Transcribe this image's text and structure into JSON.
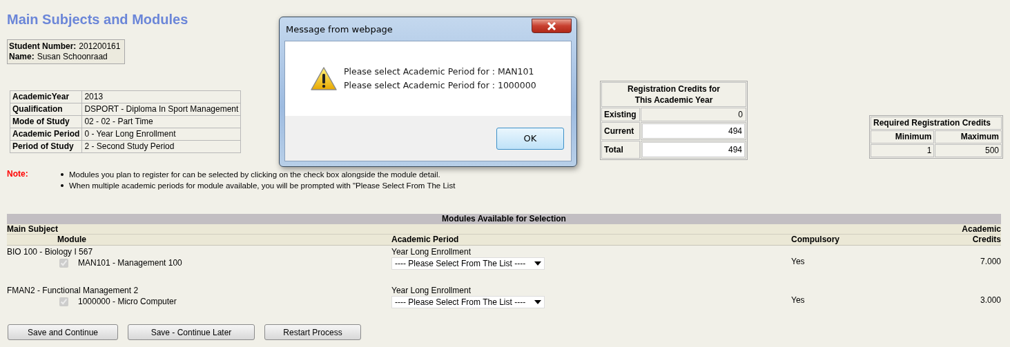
{
  "title": "Main Subjects and Modules",
  "student": {
    "number_label": "Student Number:",
    "number": "201200161",
    "name_label": "Name:",
    "name": "Susan Schoonraad"
  },
  "details": [
    {
      "label": "AcademicYear",
      "value": "2013"
    },
    {
      "label": "Qualification",
      "value": "DSPORT - Diploma In Sport Management"
    },
    {
      "label": "Mode of Study",
      "value": "02 - 02 - Part Time"
    },
    {
      "label": "Academic Period",
      "value": "0 - Year Long Enrollment"
    },
    {
      "label": "Period of Study",
      "value": "2 - Second Study Period"
    }
  ],
  "registration_credits": {
    "title_lines": [
      "Registration Credits for",
      "This Academic Year"
    ],
    "rows": [
      {
        "label": "Existing",
        "value": "0",
        "kind": "text"
      },
      {
        "label": "Current",
        "value": "494",
        "kind": "field"
      },
      {
        "label": "Total",
        "value": "494",
        "kind": "field"
      }
    ]
  },
  "required_credits": {
    "title": "Required Registration Credits",
    "columns": [
      "Minimum",
      "Maximum"
    ],
    "values": [
      "1",
      "500"
    ]
  },
  "note": {
    "label": "Note:",
    "items": [
      "Modules you plan to register for can be selected by clicking on the check box alongside the module detail.",
      "When multiple academic periods for module available, you will be prompted with \"Please Select From The List"
    ]
  },
  "modules": {
    "title": "Modules Available for Selection",
    "main_subject": "Main Subject",
    "module": "Module",
    "academic_period": "Academic Period",
    "compulsory": "Compulsory",
    "credits_lines": [
      "Academic",
      "Credits"
    ],
    "subjects": [
      {
        "subject": "BIO 100 - Biology I 567",
        "module": "MAN101 - Management 100",
        "checked": true,
        "disabled": true,
        "period": "Year Long Enrollment",
        "select_value": "---- Please Select From The List ----",
        "compulsory": "Yes",
        "credits": "7.000"
      },
      {
        "subject": "FMAN2 - Functional Management 2",
        "module": "1000000 - Micro Computer",
        "checked": true,
        "disabled": true,
        "period": "Year Long Enrollment",
        "select_value": "---- Please Select From The List ----",
        "compulsory": "Yes",
        "credits": "3.000"
      }
    ]
  },
  "buttons": [
    "Save and Continue",
    "Save - Continue Later",
    "Restart Process"
  ],
  "dialog": {
    "title": "Message from webpage",
    "lines": [
      "Please select Academic Period for : MAN101",
      "Please select Academic Period for : 1000000"
    ],
    "button": "OK"
  }
}
